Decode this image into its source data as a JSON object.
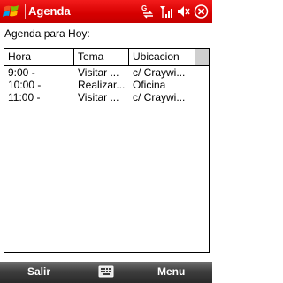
{
  "titlebar": {
    "title": "Agenda",
    "tray_icons": [
      "connectivity-icon",
      "signal-icon",
      "volume-icon",
      "close-icon"
    ]
  },
  "heading": "Agenda para Hoy:",
  "table": {
    "columns": [
      "Hora",
      "Tema",
      "Ubicacion"
    ],
    "rows": [
      [
        "9:00 -",
        "Visitar ...",
        "c/ Craywi..."
      ],
      [
        "10:00 -",
        "Realizar...",
        "Oficina"
      ],
      [
        "11:00 -",
        "Visitar ...",
        "c/ Craywi..."
      ]
    ]
  },
  "softkeys": {
    "left": "Salir",
    "right": "Menu",
    "center_icon": "keyboard-icon"
  },
  "colors": {
    "titlebar": "#d60000",
    "softbar": "#3e3e3e"
  }
}
